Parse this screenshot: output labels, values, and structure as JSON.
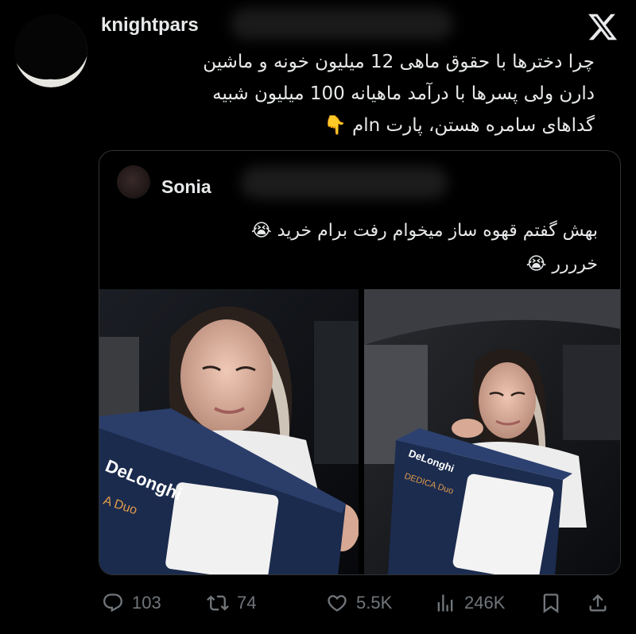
{
  "author": {
    "handle": "knightpars",
    "avatar_icon": "crescent-moon-avatar"
  },
  "tweet": {
    "lines": [
      "چرا دخترها با حقوق ماهی 12 میلیون خونه و ماشین",
      "دارن ولی پسرها با درآمد ماهیانه 100 میلیون شبیه",
      "گداهای سامره هستن، پارت nام 👇"
    ]
  },
  "quoted": {
    "name": "Sonia",
    "lines": [
      "بهش گفتم قهوه ساز میخوام رفت برام خرید 😭",
      "خرررر 😭"
    ],
    "photos": [
      {
        "alt_icon": "photo-woman-with-coffee-maker-box"
      },
      {
        "alt_icon": "photo-woman-hugging-coffee-maker-box"
      }
    ],
    "box_text": {
      "brand": "DeLonghi",
      "model_left": "A Duo",
      "model_right": "DEDICA Duo"
    }
  },
  "actions": {
    "replies": "103",
    "retweets": "74",
    "likes": "5.5K",
    "views": "246K"
  },
  "colors": {
    "background": "#000000",
    "text": "#e7e9ea",
    "muted": "#71767b",
    "border": "#2f3336"
  }
}
